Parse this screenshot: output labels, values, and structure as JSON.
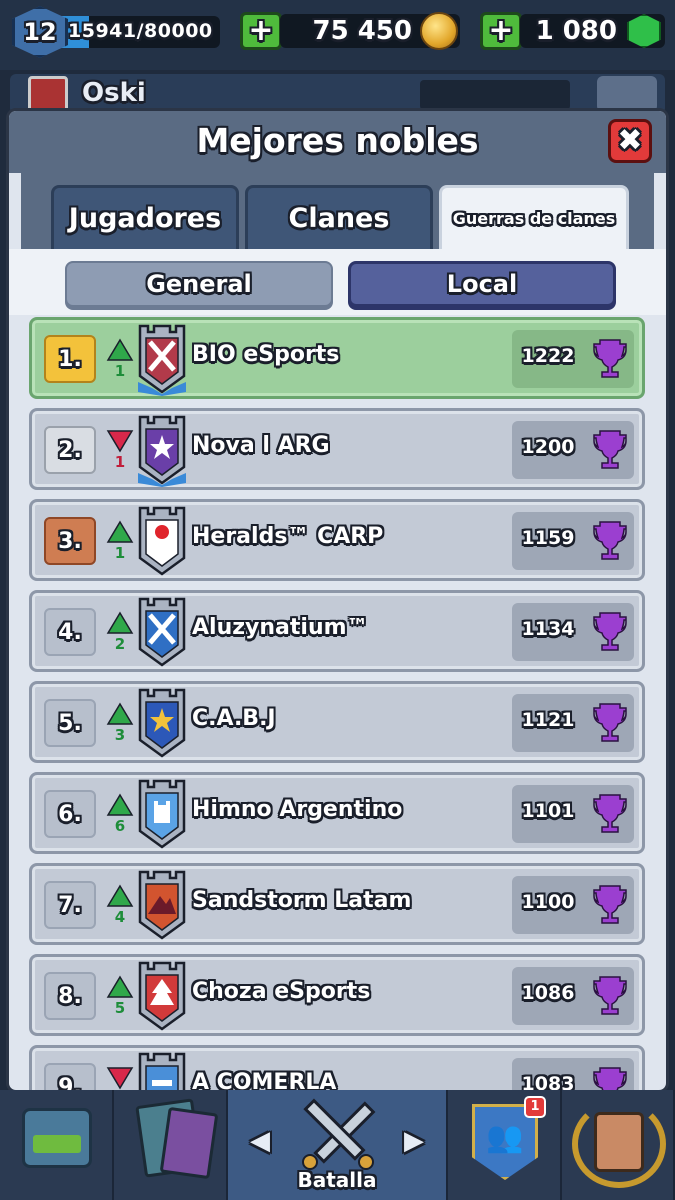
{
  "topbar": {
    "level": "12",
    "xp_text": "15941/80000",
    "xp_fraction": 0.1993,
    "gold": "75 450",
    "gems": "1 080",
    "plus_symbol": "+"
  },
  "behind": {
    "player_name": "Oski"
  },
  "modal": {
    "title": "Mejores nobles",
    "close_symbol": "✖",
    "tabs": [
      {
        "label": "Jugadores",
        "active": false
      },
      {
        "label": "Clanes",
        "active": false
      },
      {
        "label": "Guerras de clanes",
        "active": true
      }
    ],
    "subtabs": [
      {
        "label": "General",
        "active": false
      },
      {
        "label": "Local",
        "active": true
      }
    ]
  },
  "rankings": [
    {
      "rank": "1.",
      "medal": "gold",
      "trend": "up",
      "change": "1",
      "name": "BIO eSports",
      "score": "1222",
      "badge_color": "#b23a4a",
      "badge_symbol": "x-cross"
    },
    {
      "rank": "2.",
      "medal": "silver",
      "trend": "down",
      "change": "1",
      "name": "Nova l ARG",
      "score": "1200",
      "badge_color": "#6a3fa8",
      "badge_symbol": "star-burst"
    },
    {
      "rank": "3.",
      "medal": "bronze",
      "trend": "up",
      "change": "1",
      "name": "Heralds™ CARP",
      "score": "1159",
      "badge_color": "#ffffff",
      "badge_symbol": "red-dot"
    },
    {
      "rank": "4.",
      "medal": "none",
      "trend": "up",
      "change": "2",
      "name": "Aluzynatium™",
      "score": "1134",
      "badge_color": "#2f6fc4",
      "badge_symbol": "x-cross"
    },
    {
      "rank": "5.",
      "medal": "none",
      "trend": "up",
      "change": "3",
      "name": "C.A.B.J",
      "score": "1121",
      "badge_color": "#2c58b8",
      "badge_symbol": "star"
    },
    {
      "rank": "6.",
      "medal": "none",
      "trend": "up",
      "change": "6",
      "name": "Himno Argentino",
      "score": "1101",
      "badge_color": "#5aa3e6",
      "badge_symbol": "tower"
    },
    {
      "rank": "7.",
      "medal": "none",
      "trend": "up",
      "change": "4",
      "name": "Sandstorm Latam",
      "score": "1100",
      "badge_color": "#d2542f",
      "badge_symbol": "mountain"
    },
    {
      "rank": "8.",
      "medal": "none",
      "trend": "up",
      "change": "5",
      "name": "Choza eSports",
      "score": "1086",
      "badge_color": "#d23a3a",
      "badge_symbol": "tree"
    },
    {
      "rank": "9.",
      "medal": "none",
      "trend": "down",
      "change": "",
      "name": "A COMERLA",
      "score": "1083",
      "badge_color": "#4a8fd8",
      "badge_symbol": "stripe"
    }
  ],
  "bottomnav": {
    "battle_label": "Batalla",
    "left_arrow": "◀",
    "right_arrow": "▶",
    "clan_notification": "1"
  },
  "colors": {
    "trophy": "#9b3fd0",
    "up_arrow": "#2fa84a",
    "down_arrow": "#d8284a"
  }
}
